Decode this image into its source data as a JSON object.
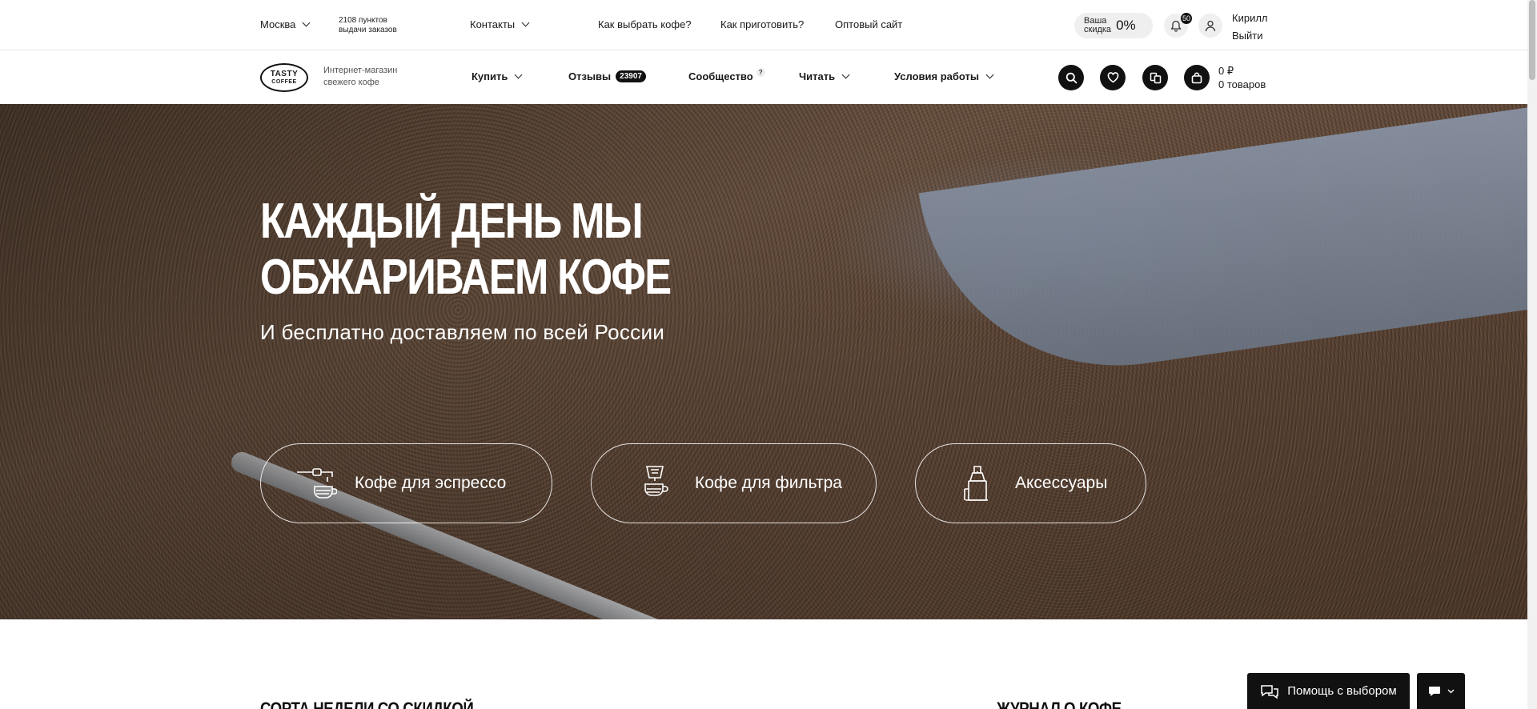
{
  "topbar": {
    "city": "Москва",
    "pickup_points_line1": "2108 пунктов",
    "pickup_points_line2": "выдачи заказов",
    "contacts": "Контакты",
    "links": [
      "Как выбрать кофе?",
      "Как приготовить?",
      "Оптовый сайт"
    ],
    "discount_label_line1": "Ваша",
    "discount_label_line2": "скидка",
    "discount_value": "0%",
    "notifications_count": "50",
    "user_name": "Кирилл",
    "logout": "Выйти"
  },
  "nav": {
    "logo_line1": "TASTY",
    "logo_line2": "COFFEE",
    "tagline_line1": "Интернет-магазин",
    "tagline_line2": "свежего кофе",
    "buy": "Купить",
    "reviews": "Отзывы",
    "reviews_count": "23907",
    "community": "Сообщество",
    "community_hint": "?",
    "read": "Читать",
    "terms": "Условия работы",
    "cart_sum": "0 ₽",
    "cart_items": "0 товаров"
  },
  "hero": {
    "title_line1": "Каждый день мы",
    "title_line2": "обжариваем кофе",
    "subtitle": "И бесплатно доставляем по всей России",
    "categories": [
      "Кофе для эспрессо",
      "Кофе для фильтра",
      "Аксессуары"
    ]
  },
  "sections": {
    "left_title": "Сорта недели со скидкой",
    "right_title": "Журнал о кофе"
  },
  "widgets": {
    "help": "Помощь с выбором"
  },
  "colors": {
    "accent": "#111111",
    "hero_base": "#5c4536"
  }
}
